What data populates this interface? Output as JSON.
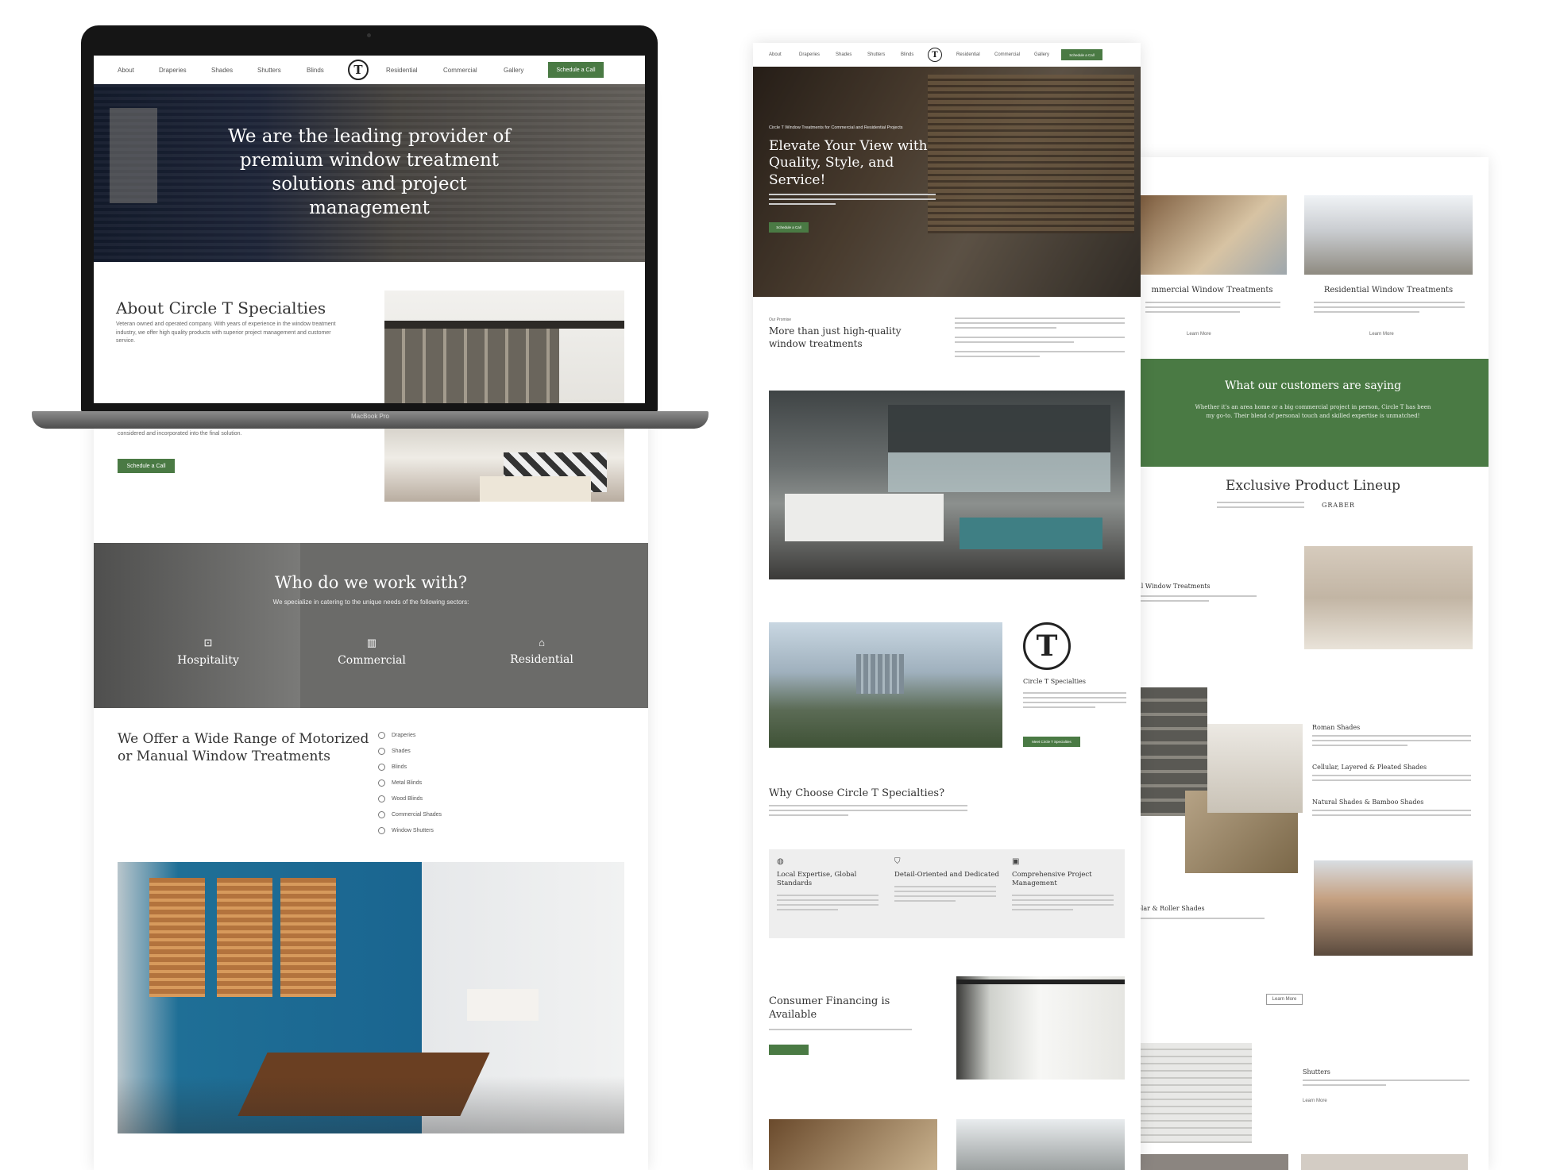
{
  "laptop": {
    "label": "MacBook Pro",
    "nav": {
      "links": [
        "About",
        "Draperies",
        "Shades",
        "Shutters",
        "Blinds",
        "Residential",
        "Commercial",
        "Gallery"
      ],
      "logo": "T",
      "cta": "Schedule a Call"
    },
    "hero": {
      "headline": "We are the leading provider of premium window treatment solutions and project management"
    },
    "about": {
      "title": "About Circle T Specialties",
      "text": "Veteran owned and operated company. With years of experience in the window treatment industry, we offer high quality products with superior project management and customer service.",
      "text2": "considered and incorporated into the final solution.",
      "button": "Schedule a Call"
    }
  },
  "left_page": {
    "who": {
      "title": "Who do we work with?",
      "subtitle": "We specialize in catering to the unique needs of the following sectors:",
      "sectors": [
        {
          "icon": "luggage-icon",
          "label": "Hospitality"
        },
        {
          "icon": "building-icon",
          "label": "Commercial"
        },
        {
          "icon": "home-icon",
          "label": "Residential"
        }
      ]
    },
    "offer": {
      "title": "We Offer a Wide Range of Motorized or Manual Window Treatments",
      "items": [
        "Draperies",
        "Shades",
        "Blinds",
        "Metal Blinds",
        "Wood Blinds",
        "Commercial Shades",
        "Window Shutters"
      ]
    }
  },
  "middle_page": {
    "nav": {
      "links": [
        "About",
        "Draperies",
        "Shades",
        "Shutters",
        "Blinds",
        "Residential",
        "Commercial",
        "Gallery"
      ],
      "logo": "T",
      "cta": "Schedule a Call"
    },
    "hero": {
      "eyebrow": "Circle T Window Treatments for Commercial and Residential Projects",
      "headline": "Elevate Your View with Quality, Style, and Service!",
      "button": "Schedule a Call"
    },
    "intro": {
      "eyebrow": "Our Promise",
      "title": "More than just high-quality window treatments"
    },
    "company": {
      "logo": "T",
      "name": "Circle T Specialties",
      "button": "Meet Circle T Specialties"
    },
    "why": {
      "title": "Why Choose Circle T Specialties?",
      "features": [
        {
          "icon": "globe-icon",
          "title": "Local Expertise, Global Standards"
        },
        {
          "icon": "shield-icon",
          "title": "Detail-Oriented and Dedicated"
        },
        {
          "icon": "clipboard-icon",
          "title": "Comprehensive Project Management"
        }
      ]
    },
    "financing": {
      "title": "Consumer Financing is Available"
    }
  },
  "right_page": {
    "cards": [
      {
        "title": "mmercial Window Treatments",
        "link": "Learn More"
      },
      {
        "title": "Residential Window Treatments",
        "link": "Learn More"
      }
    ],
    "testimonials": {
      "title": "What our customers are saying",
      "quote": "Whether it's an area home or a big commercial project in person, Circle T has been my go-to. Their blend of personal touch and skilled expertise is unmatched!"
    },
    "products": {
      "title": "Exclusive Product Lineup",
      "brand": "GRABER"
    },
    "shade_section": "al Window Treatments",
    "roman_title": "Roman Shades",
    "cellular_title": "Cellular, Layered & Pleated Shades",
    "natural_title": "Natural Shades & Bamboo Shades",
    "solar_title": "olar & Roller Shades",
    "learn_more": "Learn More",
    "shutters_title": "Shutters",
    "shutters_link": "Learn More"
  },
  "colors": {
    "brand_green": "#4a7a44",
    "grey_band": "#6a6a68"
  }
}
